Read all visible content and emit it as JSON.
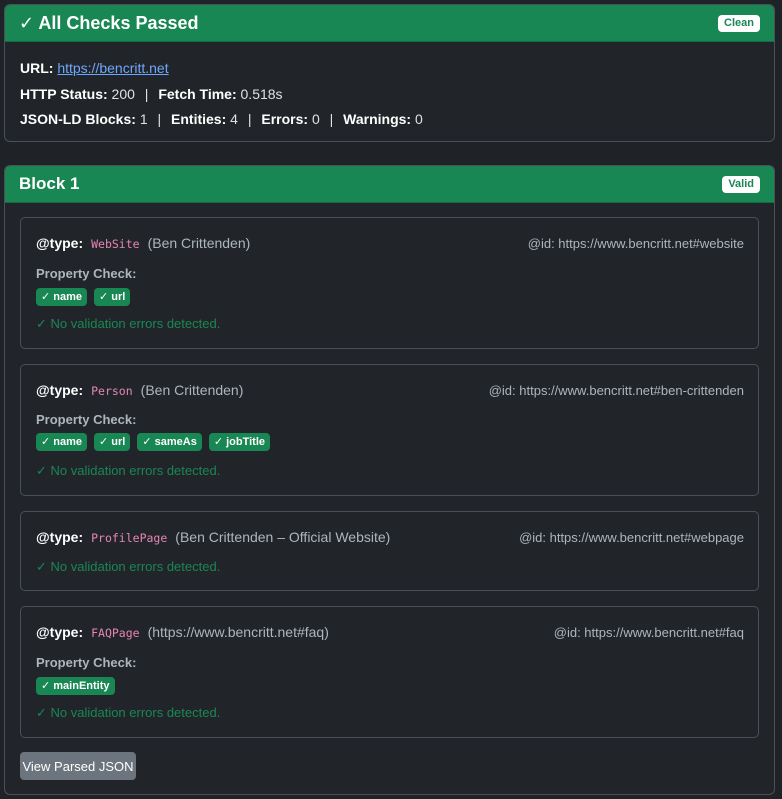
{
  "summary": {
    "title": "✓ All Checks Passed",
    "badge": "Clean",
    "url_label": "URL:",
    "url": "https://bencritt.net",
    "http_status_label": "HTTP Status:",
    "http_status": "200",
    "fetch_time_label": "Fetch Time:",
    "fetch_time": "0.518s",
    "blocks_label": "JSON-LD Blocks:",
    "blocks": "1",
    "entities_label": "Entities:",
    "entities": "4",
    "errors_label": "Errors:",
    "errors": "0",
    "warnings_label": "Warnings:",
    "warnings": "0"
  },
  "block": {
    "title": "Block 1",
    "badge": "Valid",
    "type_label": "@type:",
    "property_check_label": "Property Check:",
    "no_errors_text": "✓ No validation errors detected.",
    "view_json_label": "View Parsed JSON",
    "entities": [
      {
        "type": "WebSite",
        "name": "(Ben Crittenden)",
        "id": "@id: https://www.bencritt.net#website",
        "props": [
          "✓ name",
          "✓ url"
        ]
      },
      {
        "type": "Person",
        "name": "(Ben Crittenden)",
        "id": "@id: https://www.bencritt.net#ben-crittenden",
        "props": [
          "✓ name",
          "✓ url",
          "✓ sameAs",
          "✓ jobTitle"
        ]
      },
      {
        "type": "ProfilePage",
        "name": "(Ben Crittenden – Official Website)",
        "id": "@id: https://www.bencritt.net#webpage",
        "props": []
      },
      {
        "type": "FAQPage",
        "name": "(https://www.bencritt.net#faq)",
        "id": "@id: https://www.bencritt.net#faq",
        "props": [
          "✓ mainEntity"
        ]
      }
    ]
  },
  "colors": {
    "success": "#198754",
    "background": "#212529",
    "border": "#495057",
    "code": "#e685b5",
    "link": "#6ea8fe"
  }
}
